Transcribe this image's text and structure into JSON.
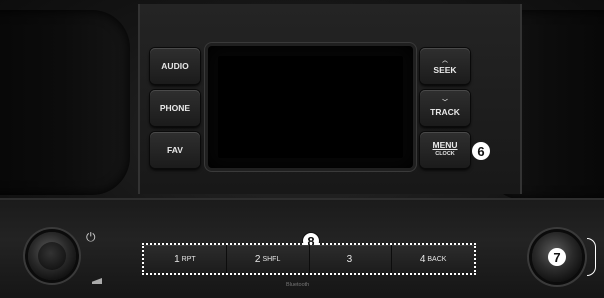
{
  "left_buttons": {
    "audio": "AUDIO",
    "phone": "PHONE",
    "fav": "FAV"
  },
  "right_buttons": {
    "seek": "SEEK",
    "track": "TRACK",
    "menu": "MENU",
    "menu_sub": "CLOCK"
  },
  "callouts": {
    "menu": "6",
    "presets": "8",
    "tune_knob": "7"
  },
  "presets": [
    {
      "num": "1",
      "tag": "RPT"
    },
    {
      "num": "2",
      "tag": "SHFL"
    },
    {
      "num": "3",
      "tag": ""
    },
    {
      "num": "4",
      "tag": "BACK"
    }
  ],
  "power_symbol": "⏻",
  "bluetooth_label": "Bluetooth",
  "icons": [
    "power-icon",
    "seek-up-icon",
    "track-down-icon",
    "volume-knob",
    "tune-knob"
  ]
}
